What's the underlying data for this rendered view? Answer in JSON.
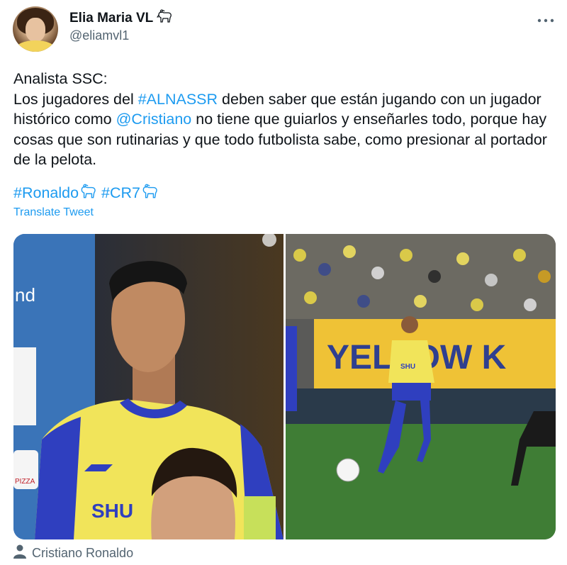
{
  "author": {
    "display_name": "Elia Maria VL",
    "handle": "@eliamvl1",
    "badge_icon": "goat-icon"
  },
  "more_icon": "more-icon",
  "tweet": {
    "line1": "Analista SSC:",
    "text_before_tag": "Los jugadores del ",
    "hashtag1": "#ALNASSR",
    "text_after_tag": " deben saber que están jugando con un jugador histórico como ",
    "mention": "@Cristiano",
    "text_end": " no tiene que guiarlos y enseñarles todo, porque hay cosas que son rutinarias y que todo futbolista sabe, como presionar al portador de la pelota.",
    "hashtag2": "#Ronaldo",
    "hashtag3": "#CR7"
  },
  "translate_label": "Translate Tweet",
  "media": {
    "photo1": {
      "description_icon": "photo",
      "jersey_text": "SHU",
      "sign_text": "nd",
      "patch_text": "PIZZA"
    },
    "photo2": {
      "banner_text": "YELLOW K",
      "jersey_text": "SHU"
    }
  },
  "tagged_user": {
    "icon": "person-icon",
    "name": "Cristiano Ronaldo"
  },
  "colors": {
    "link": "#1d9bf0",
    "secondary_text": "#536471",
    "jersey_yellow": "#f2e65a",
    "jersey_blue": "#2f3fbf",
    "pitch_green": "#3f7d35"
  }
}
